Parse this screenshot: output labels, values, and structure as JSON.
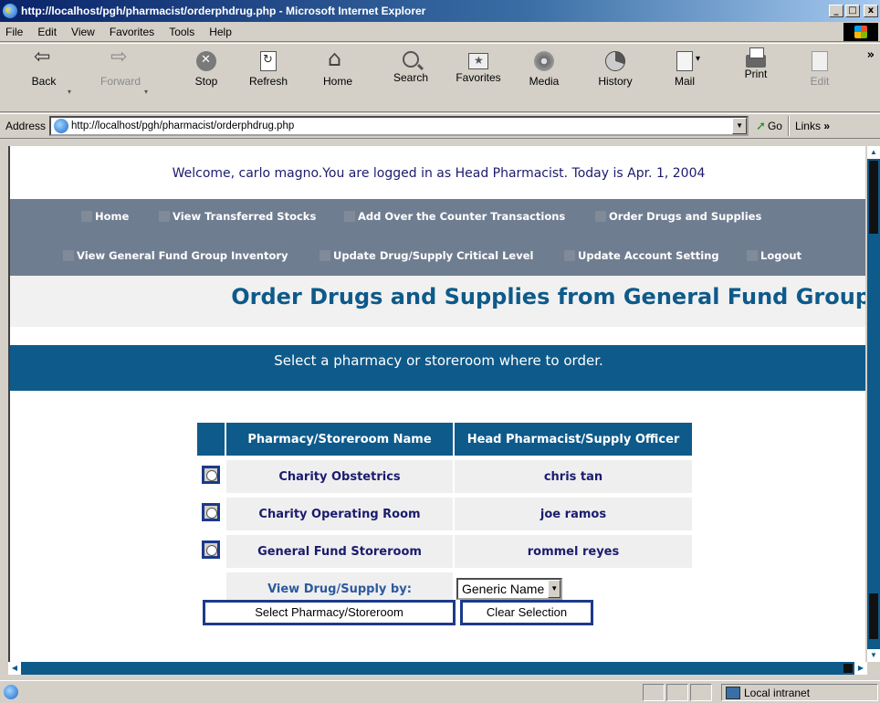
{
  "window": {
    "title": "http://localhost/pgh/pharmacist/orderphdrug.php - Microsoft Internet Explorer",
    "controls": [
      "_",
      "□",
      "x"
    ]
  },
  "menu": [
    "File",
    "Edit",
    "View",
    "Favorites",
    "Tools",
    "Help"
  ],
  "toolbar": {
    "back": "Back",
    "forward": "Forward",
    "stop": "Stop",
    "refresh": "Refresh",
    "home": "Home",
    "search": "Search",
    "favorites": "Favorites",
    "media": "Media",
    "history": "History",
    "mail": "Mail",
    "print": "Print",
    "edit": "Edit",
    "more": "»"
  },
  "address": {
    "label": "Address",
    "url": "http://localhost/pgh/pharmacist/orderphdrug.php",
    "go": "Go",
    "links": "Links",
    "links_more": "»"
  },
  "page": {
    "welcome": "Welcome, carlo  magno.You are logged in as Head Pharmacist. Today is Apr. 1, 2004",
    "nav": {
      "home": "Home",
      "view_transferred": "View Transferred Stocks",
      "add_otc": "Add Over the Counter Transactions",
      "order_drugs": "Order Drugs and Supplies",
      "view_gf_inventory": "View General Fund Group Inventory",
      "update_critical": "Update Drug/Supply Critical Level",
      "update_account": "Update Account Setting",
      "logout": "Logout"
    },
    "title": "Order Drugs and Supplies from General Fund Group",
    "instruction": "Select a pharmacy or storeroom where to order.",
    "table": {
      "col_name": "Pharmacy/Storeroom Name",
      "col_head": "Head Pharmacist/Supply Officer",
      "rows": [
        {
          "name": "Charity Obstetrics",
          "head": "chris tan"
        },
        {
          "name": "Charity Operating Room",
          "head": "joe ramos"
        },
        {
          "name": "General Fund Storeroom",
          "head": "rommel reyes"
        }
      ],
      "view_by_label": "View Drug/Supply by:",
      "view_by_value": "Generic Name"
    },
    "buttons": {
      "select": "Select Pharmacy/Storeroom",
      "clear": "Clear Selection"
    }
  },
  "status": {
    "zone": "Local intranet"
  },
  "colors": {
    "accent_blue": "#0e5a8a",
    "nav_gray": "#6f7d90",
    "text_navy": "#1b1b6e"
  }
}
